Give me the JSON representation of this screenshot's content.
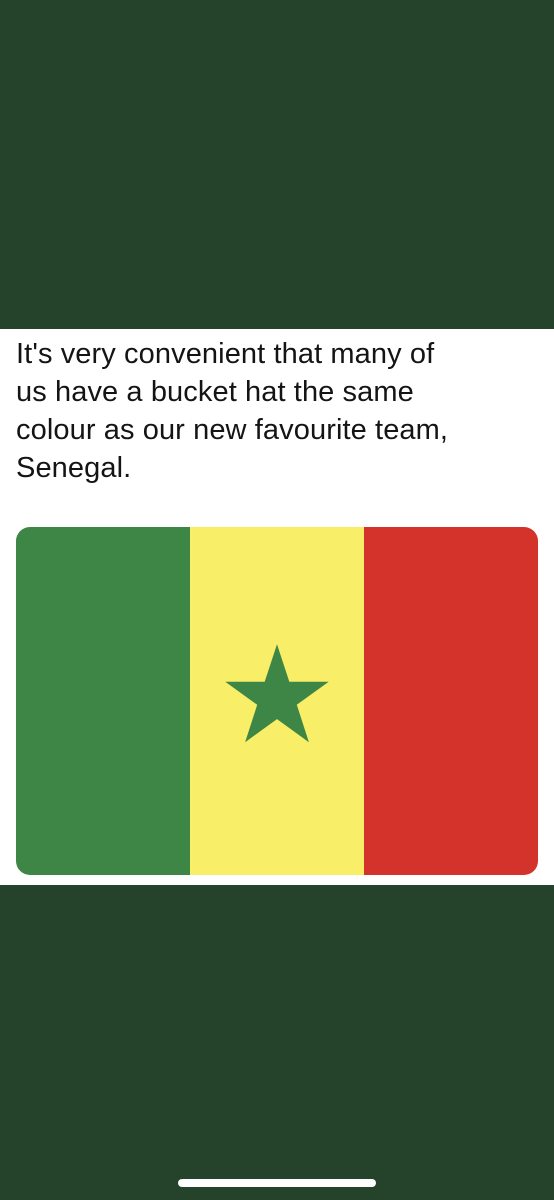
{
  "post": {
    "text_line_1": "It's very convenient that many of",
    "text_line_2": "us have a bucket hat the same",
    "text_line_3": "colour as our new favourite team,",
    "text_line_4": "Senegal."
  },
  "flag": {
    "icon": "senegal-flag",
    "star_icon": "star-icon",
    "colors": {
      "green": "#3d8646",
      "yellow": "#f8ee67",
      "red": "#d4332c",
      "star": "#3d8646"
    }
  },
  "theme": {
    "background": "#25432a",
    "card_background": "#ffffff",
    "text_color": "#141414"
  }
}
